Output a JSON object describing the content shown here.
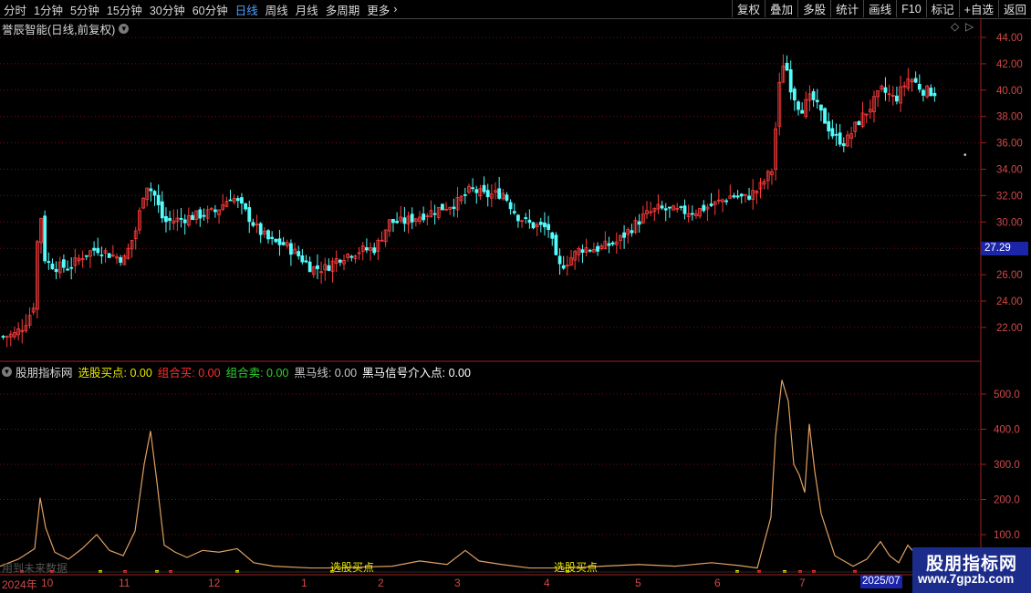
{
  "toolbar": {
    "periods": [
      "分时",
      "1分钟",
      "5分钟",
      "15分钟",
      "30分钟",
      "60分钟",
      "日线",
      "周线",
      "月线",
      "多周期",
      "更多"
    ],
    "active_period": "日线",
    "more_icon": "chevron-right-icon",
    "right_buttons": [
      "复权",
      "叠加",
      "多股",
      "统计",
      "画线",
      "F10",
      "标记",
      "+自选",
      "返回"
    ]
  },
  "main_panel": {
    "title": "誉辰智能(日线,前复权)",
    "collapse_icon": "chevron-down-circle-icon",
    "diamond_icon": "diamond-icon",
    "price_tag": "27.29",
    "y_ticks": [
      "44.00",
      "42.00",
      "40.00",
      "38.00",
      "36.00",
      "34.00",
      "32.00",
      "30.00",
      "28.00",
      "26.00",
      "24.00",
      "22.00"
    ]
  },
  "indicator_panel": {
    "title": "股朋指标网",
    "fields": [
      {
        "label": "选股买点: 0.00",
        "color": "#e8e800"
      },
      {
        "label": "组合买: 0.00",
        "color": "#ff3030"
      },
      {
        "label": "组合卖: 0.00",
        "color": "#30d030"
      },
      {
        "label": "黑马线: 0.00",
        "color": "#c8c8c8"
      },
      {
        "label": "黑马信号介入点: 0.00",
        "color": "#ffffff"
      }
    ],
    "y_ticks": [
      "500.0",
      "400.0",
      "300.0",
      "200.0",
      "100.0"
    ],
    "signal_labels": [
      "选股买点",
      "选股买点"
    ],
    "ghost_text": "用到未来数据"
  },
  "date_axis": {
    "labels": [
      "2024年",
      "10",
      "11",
      "12",
      "1",
      "2",
      "3",
      "4",
      "5",
      "6",
      "7"
    ],
    "year_box": "2025/07"
  },
  "watermark": {
    "title": "股朋指标网",
    "url": "www.7gpzb.com"
  },
  "colors": {
    "up": "#ff3c3c",
    "down": "#54fcfc",
    "curve": "#e0a060",
    "grid": "#7a1010",
    "accent": "#1c25a8"
  }
}
